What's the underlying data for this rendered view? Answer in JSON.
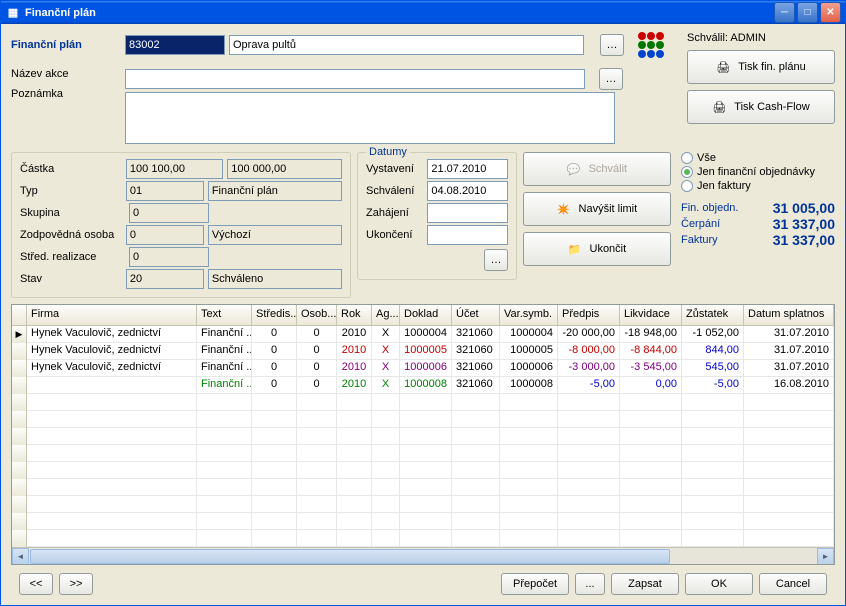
{
  "window": {
    "title": "Finanční plán"
  },
  "header": {
    "label": "Finanční plán",
    "code": "83002",
    "name": "Oprava pultů",
    "approved_label": "Schválil: ADMIN",
    "btn_print_plan": "Tisk fin. plánu",
    "btn_print_cashflow": "Tisk Cash-Flow"
  },
  "fields": {
    "nazev_akce_label": "Název akce",
    "nazev_akce": "",
    "poznamka_label": "Poznámka",
    "poznamka": "",
    "castka_label": "Částka",
    "castka1": "100 100,00",
    "castka2": "100 000,00",
    "typ_label": "Typ",
    "typ_code": "01",
    "typ_name": "Finanční plán",
    "skupina_label": "Skupina",
    "skupina": "0",
    "zodp_label": "Zodpovědná osoba",
    "zodp_code": "0",
    "zodp_name": "Výchozí",
    "stred_label": "Střed. realizace",
    "stred": "0",
    "stav_label": "Stav",
    "stav_code": "20",
    "stav_name": "Schváleno"
  },
  "dates": {
    "group": "Datumy",
    "vystaveni_label": "Vystavení",
    "vystaveni": "21.07.2010",
    "schvaleni_label": "Schválení",
    "schvaleni": "04.08.2010",
    "zahajeni_label": "Zahájení",
    "zahajeni": "",
    "ukonceni_label": "Ukončení",
    "ukonceni": ""
  },
  "actions": {
    "schvalit": "Schválit",
    "navysit": "Navýšit limit",
    "ukoncit": "Ukončit"
  },
  "filter": {
    "vse": "Vše",
    "objednavky": "Jen finanční objednávky",
    "faktury": "Jen faktury",
    "selected": "objednavky"
  },
  "summary": {
    "objednavky_label": "Fin. objedn.",
    "objednavky": "31 005,00",
    "cerpani_label": "Čerpání",
    "cerpani": "31 337,00",
    "faktury_label": "Faktury",
    "faktury": "31 337,00"
  },
  "grid": {
    "columns": [
      "Firma",
      "Text",
      "Středis...",
      "Osob...",
      "Rok",
      "Ag...",
      "Doklad",
      "Účet",
      "Var.symb.",
      "Předpis",
      "Likvidace",
      "Zůstatek",
      "Datum splatnos"
    ],
    "rows": [
      {
        "firma": "Hynek Vaculovič, zednictví",
        "text": "Finanční ...",
        "stred": "0",
        "osob": "0",
        "rok": "2010",
        "ag": "X",
        "doklad": "1000004",
        "ucet": "321060",
        "vs": "1000004",
        "predpis": "-20 000,00",
        "likv": "-18 948,00",
        "zust": "-1 052,00",
        "splat": "31.07.2010",
        "color": "black",
        "marker": "▶"
      },
      {
        "firma": "Hynek Vaculovič, zednictví",
        "text": "Finanční ...",
        "stred": "0",
        "osob": "0",
        "rok": "2010",
        "ag": "X",
        "doklad": "1000005",
        "ucet": "321060",
        "vs": "1000005",
        "predpis": "-8 000,00",
        "likv": "-8 844,00",
        "zust": "844,00",
        "splat": "31.07.2010",
        "color": "red"
      },
      {
        "firma": "Hynek Vaculovič, zednictví",
        "text": "Finanční ...",
        "stred": "0",
        "osob": "0",
        "rok": "2010",
        "ag": "X",
        "doklad": "1000006",
        "ucet": "321060",
        "vs": "1000006",
        "predpis": "-3 000,00",
        "likv": "-3 545,00",
        "zust": "545,00",
        "splat": "31.07.2010",
        "color": "purple"
      },
      {
        "firma": "",
        "text": "Finanční ...",
        "stred": "0",
        "osob": "0",
        "rok": "2010",
        "ag": "X",
        "doklad": "1000008",
        "ucet": "321060",
        "vs": "1000008",
        "predpis": "-5,00",
        "likv": "0,00",
        "zust": "-5,00",
        "splat": "16.08.2010",
        "color": "green"
      }
    ]
  },
  "bottom": {
    "prepocet": "Přepočet",
    "zapsat": "Zapsat",
    "ok": "OK",
    "cancel": "Cancel",
    "prev": "<<",
    "next": ">>",
    "dots": "..."
  }
}
